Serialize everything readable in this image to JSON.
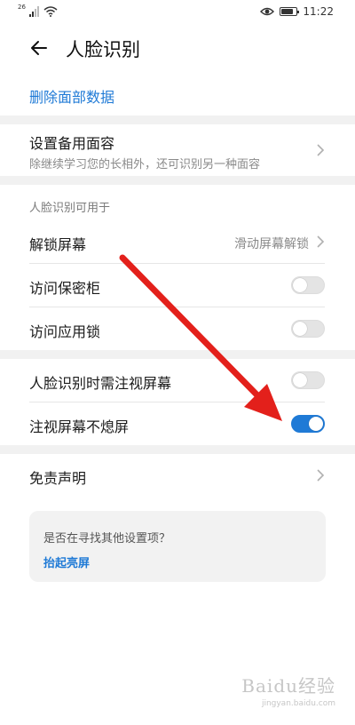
{
  "status_bar": {
    "signal_tag": "26",
    "time": "11:22",
    "battery_level": 0.8
  },
  "header": {
    "title": "人脸识别"
  },
  "delete_link": "删除面部数据",
  "alt_face": {
    "label": "设置备用面容",
    "subtitle": "除继续学习您的长相外，还可识别另一种面容"
  },
  "usage": {
    "caption": "人脸识别可用于",
    "unlock": {
      "label": "解锁屏幕",
      "value": "滑动屏幕解锁"
    },
    "safe": {
      "label": "访问保密柜",
      "enabled": false
    },
    "app_lock": {
      "label": "访问应用锁",
      "enabled": false
    }
  },
  "attention": {
    "require_gaze": {
      "label": "人脸识别时需注视屏幕",
      "enabled": false
    },
    "gaze_keep_on": {
      "label": "注视屏幕不熄屏",
      "enabled": true
    }
  },
  "disclaimer": {
    "label": "免责声明"
  },
  "suggestion": {
    "question": "是否在寻找其他设置项？",
    "link": "抬起亮屏"
  },
  "colors": {
    "accent": "#1f7ad6",
    "annotation_arrow": "#e3201b"
  },
  "watermark": {
    "brand": "Baidu经验",
    "url": "jingyan.baidu.com"
  }
}
